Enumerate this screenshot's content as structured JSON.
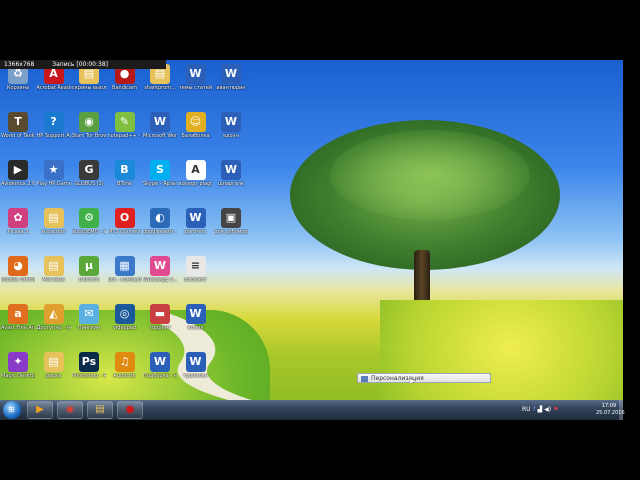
{
  "recorder": {
    "size": "1366x768",
    "record_label": "Запись [00:00:38]"
  },
  "icons": [
    {
      "label": "Корзина",
      "icon": "recycle-bin-icon",
      "color": "#7da0c8",
      "glyph": "♻",
      "col": 0,
      "row": 0
    },
    {
      "label": "Acrobat Reader DC",
      "icon": "acrobat-icon",
      "color": "#c8181e",
      "glyph": "A",
      "col": 1,
      "row": 0
    },
    {
      "label": "скрины выплат",
      "icon": "folder-icon",
      "color": "#e7c15a",
      "glyph": "▤",
      "col": 2,
      "row": 0
    },
    {
      "label": "Bandicam",
      "icon": "bandicam-icon",
      "color": "#b81818",
      "glyph": "●",
      "col": 3,
      "row": 0
    },
    {
      "label": "sharkprom...",
      "icon": "folder-icon",
      "color": "#e7c15a",
      "glyph": "▤",
      "col": 4,
      "row": 0
    },
    {
      "label": "темы статей",
      "icon": "word-doc-icon",
      "color": "#2b5fb8",
      "glyph": "W",
      "col": 5,
      "row": 0
    },
    {
      "label": "авантюрин",
      "icon": "word-doc-icon",
      "color": "#2b5fb8",
      "glyph": "W",
      "col": 6,
      "row": 0
    },
    {
      "label": "World of Tanks",
      "icon": "world-of-tanks-icon",
      "color": "#5a4a30",
      "glyph": "T",
      "col": 0,
      "row": 1
    },
    {
      "label": "HP Support Assistant",
      "icon": "hp-support-icon",
      "color": "#1a7ad0",
      "glyph": "?",
      "col": 1,
      "row": 1
    },
    {
      "label": "Start Tor Browser",
      "icon": "tor-icon",
      "color": "#5aa040",
      "glyph": "◉",
      "col": 2,
      "row": 1
    },
    {
      "label": "notepad++ - Ярлык",
      "icon": "notepad-icon",
      "color": "#80c040",
      "glyph": "✎",
      "col": 3,
      "row": 1
    },
    {
      "label": "Microsoft Word 2010",
      "icon": "word-icon",
      "color": "#2b5fb8",
      "glyph": "W",
      "col": 4,
      "row": 1
    },
    {
      "label": "Балаболка",
      "icon": "balabolka-icon",
      "color": "#e0b020",
      "glyph": "☺",
      "col": 5,
      "row": 1
    },
    {
      "label": "вдохн",
      "icon": "word-doc-icon",
      "color": "#2b5fb8",
      "glyph": "W",
      "col": 6,
      "row": 1
    },
    {
      "label": "Avidemux 2.6 - 64 bits",
      "icon": "avidemux-icon",
      "color": "#2a2a2a",
      "glyph": "▶",
      "col": 0,
      "row": 2
    },
    {
      "label": "Play HP Games",
      "icon": "hp-games-icon",
      "color": "#3a70c8",
      "glyph": "★",
      "col": 1,
      "row": 2
    },
    {
      "label": "GLOBUS (2)",
      "icon": "globus-icon",
      "color": "#3a3a3a",
      "glyph": "G",
      "col": 2,
      "row": 2
    },
    {
      "label": "BTone",
      "icon": "btone-icon",
      "color": "#1a8ad8",
      "glyph": "B",
      "col": 3,
      "row": 2
    },
    {
      "label": "Skype - Ярлык",
      "icon": "skype-icon",
      "color": "#00aff0",
      "glyph": "S",
      "col": 4,
      "row": 2
    },
    {
      "label": "advego_plagi...",
      "icon": "advego-icon",
      "color": "#ffffff",
      "glyph": "A",
      "col": 5,
      "row": 2
    },
    {
      "label": "шпаргалк",
      "icon": "word-doc-icon",
      "color": "#2b5fb8",
      "glyph": "W",
      "col": 6,
      "row": 2
    },
    {
      "label": "Picasa 3",
      "icon": "picasa-icon",
      "color": "#d04080",
      "glyph": "✿",
      "col": 0,
      "row": 3
    },
    {
      "label": "subscribe",
      "icon": "folder-icon",
      "color": "#e7c15a",
      "glyph": "▤",
      "col": 1,
      "row": 3
    },
    {
      "label": "autoDEMO - app",
      "icon": "autodemo-icon",
      "color": "#40b048",
      "glyph": "⚙",
      "col": 2,
      "row": 3
    },
    {
      "label": "MTS Connect",
      "icon": "mts-icon",
      "color": "#e02020",
      "glyph": "O",
      "col": 3,
      "row": 3
    },
    {
      "label": "googleearth - Ярлык",
      "icon": "google-earth-icon",
      "color": "#2a6ab8",
      "glyph": "◐",
      "col": 4,
      "row": 3
    },
    {
      "label": "partners",
      "icon": "word-doc-icon",
      "color": "#2b5fb8",
      "glyph": "W",
      "col": 5,
      "row": 3
    },
    {
      "label": "для дублирован...",
      "icon": "image-file-icon",
      "color": "#444444",
      "glyph": "▣",
      "col": 6,
      "row": 3
    },
    {
      "label": "Mozilla Firefox",
      "icon": "firefox-icon",
      "color": "#e06a1a",
      "glyph": "◕",
      "col": 0,
      "row": 4
    },
    {
      "label": "Магазин",
      "icon": "folder-icon",
      "color": "#e7c15a",
      "glyph": "▤",
      "col": 1,
      "row": 4
    },
    {
      "label": "uTorrent",
      "icon": "utorrent-icon",
      "color": "#5aa83a",
      "glyph": "µ",
      "col": 2,
      "row": 4
    },
    {
      "label": "bot - компьютер",
      "icon": "bot-icon",
      "color": "#3a7ac8",
      "glyph": "▦",
      "col": 3,
      "row": 4
    },
    {
      "label": "WhatsApp C...",
      "icon": "whatsapp-icon",
      "color": "#e04a90",
      "glyph": "W",
      "col": 4,
      "row": 4
    },
    {
      "label": "Блокнот",
      "icon": "notepad-file-icon",
      "color": "#e8e8e8",
      "glyph": "≡",
      "col": 5,
      "row": 4
    },
    {
      "label": "Avast Free Antivirus",
      "icon": "avast-icon",
      "color": "#e07020",
      "glyph": "a",
      "col": 0,
      "row": 5
    },
    {
      "label": "Доступно - несложно",
      "icon": "pizza-icon",
      "color": "#e0a030",
      "glyph": "◭",
      "col": 1,
      "row": 5
    },
    {
      "label": "Пингвин",
      "icon": "message-icon",
      "color": "#5ab0e0",
      "glyph": "✉",
      "col": 2,
      "row": 5
    },
    {
      "label": "videopad",
      "icon": "videopad-icon",
      "color": "#1a5a9a",
      "glyph": "◎",
      "col": 3,
      "row": 5
    },
    {
      "label": "торрент",
      "icon": "flag-file-icon",
      "color": "#c84040",
      "glyph": "▬",
      "col": 4,
      "row": 5
    },
    {
      "label": "копия",
      "icon": "word-doc-icon",
      "color": "#2b5fb8",
      "glyph": "W",
      "col": 5,
      "row": 5
    },
    {
      "label": "Magic Desktop",
      "icon": "magic-desktop-icon",
      "color": "#8a3ac8",
      "glyph": "✦",
      "col": 0,
      "row": 6
    },
    {
      "label": "papka",
      "icon": "folder-icon",
      "color": "#e7c15a",
      "glyph": "▤",
      "col": 1,
      "row": 6
    },
    {
      "label": "Photoshop - Ярлык",
      "icon": "photoshop-icon",
      "color": "#0a2a4a",
      "glyph": "Ps",
      "col": 2,
      "row": 6
    },
    {
      "label": "Audacity",
      "icon": "audacity-icon",
      "color": "#e08a10",
      "glyph": "♫",
      "col": 3,
      "row": 6
    },
    {
      "label": "Подборка - несложно",
      "icon": "word-doc-icon",
      "color": "#2b5fb8",
      "glyph": "W",
      "col": 4,
      "row": 6
    },
    {
      "label": "туриальн",
      "icon": "word-doc-icon",
      "color": "#2b5fb8",
      "glyph": "W",
      "col": 5,
      "row": 6
    }
  ],
  "taskbar": {
    "items": [
      {
        "name": "media-player-button",
        "icon": "media-player-icon",
        "glyph": "▶",
        "color": "#f0a020"
      },
      {
        "name": "chrome-button",
        "icon": "chrome-icon",
        "glyph": "◉",
        "color": "#e04030"
      },
      {
        "name": "explorer-button",
        "icon": "folder-icon",
        "glyph": "▤",
        "color": "#e7c15a"
      },
      {
        "name": "bandicam-button",
        "icon": "bandicam-icon",
        "glyph": "●",
        "color": "#d01818"
      }
    ],
    "lang": "RU",
    "time": "17:09",
    "date": "25.07.2016"
  },
  "tooltip": {
    "text": "Персонализация"
  }
}
